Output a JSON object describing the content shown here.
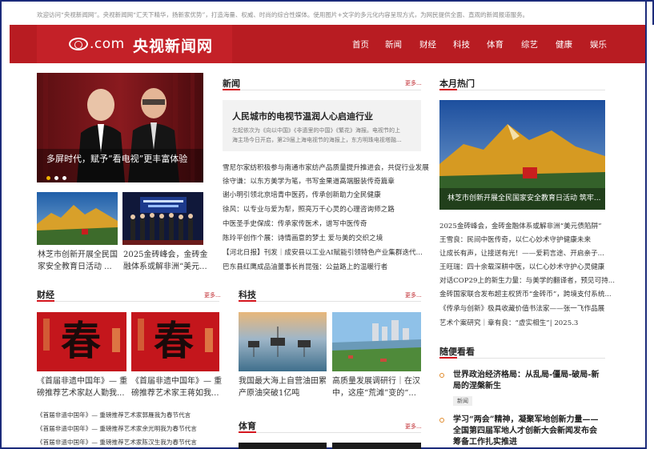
{
  "top_note": "欢迎访问“央视新闻网”。央视新闻网“汇天下精华，扬新家优势”，打造海量、权威、时尚的综合性媒体。使用图片+文字的多元化内容呈现方式，为网民提供全面、直观的新闻报道服务。",
  "logo": {
    "en": ".com",
    "cn": "央视新闻网"
  },
  "nav": [
    "首页",
    "新闻",
    "财经",
    "科技",
    "体育",
    "综艺",
    "健康",
    "娱乐"
  ],
  "slider": {
    "caption": "多屏时代，赋予“看电视”更丰富体验",
    "dots": 3,
    "active": 0
  },
  "thumbs": [
    {
      "caption_1": "林芝市创新开展全民国",
      "caption_2": "家安全教育日活动 ..."
    },
    {
      "caption_1": "2025金砖峰会，金砖金",
      "caption_2": "融体系或解非洲“美元..."
    }
  ],
  "news": {
    "title": "新闻",
    "more": "更多...",
    "featured": {
      "title": "人民城市的电视节温润人心启迪行业",
      "summary_1": "左起依次为《向以中国》《非遗里的中国》《繁花》海报。电视节的上",
      "summary_2": "海主场今日开启，第29届上海电视节的海报上，东方明珠电视塔融..."
    },
    "items": [
      "雪尼尔家纺积极参与南通市家纺产品质量提升推进会，共促行业发展",
      "徐守谦：以东方美学为笔，书写金果道高端服装传奇篇章",
      "谢小明引领北京培青中医药，传承创新助力全民健康",
      "徐风：以专业与爱为犁，照亮万千心灵的心理咨询师之路",
      "中医圣手史保成：传承家传医术，谱写中医传奇",
      "陈玲平创作个展：诗情画意的梦土 爱与美的交织之境",
      "【河北日报】刊发｜成安县以工业AI赋能引领特色产业集群迭代...",
      "巴东县红鹰成品油董事长肖昆强：公益路上的温暖行者"
    ]
  },
  "hot": {
    "title": "本月热门",
    "image_caption": "林芝市创新开展全民国家安全教育日活动 筑牢...",
    "items": [
      "2025金砖峰会，金砖金融体系或解非洲“美元债陷阱”",
      "王雪良：民间中医传奇，以仁心妙术守护健康未来",
      "让成长有声，让接送有光！——爱莉言途、开启亲子...",
      "王旺瑞：四十余载深耕中医，以仁心妙术守护心灵健康",
      "对话COP29上的新生力量：与美学的翻译者，预见可持...",
      "金砖国家联合发布超主权货币“金砖币”，跨境支付系统...",
      "《传承与创新》极具收藏价值书法家——张一飞作品展",
      "艺术个案研究｜章有良：“虚实相生”| 2025.3"
    ]
  },
  "finance": {
    "title": "财经",
    "more": "更多...",
    "cards": [
      {
        "caption_1": "《首届非遗中国年》— 重",
        "caption_2": "磅推荐艺术家赵人勤我..."
      },
      {
        "caption_1": "《首届非遗中国年》— 重",
        "caption_2": "磅推荐艺术家王蒋如我..."
      }
    ],
    "list": [
      "《首届非遗中国年》— 重磅推荐艺术家郭雁我为春节代言",
      "《首届非遗中国年》— 重磅推荐艺术家余光明我为春节代言",
      "《首届非遗中国年》— 重磅推荐艺术家陈汉生我为春节代言"
    ],
    "poster_char": "春"
  },
  "tech": {
    "title": "科技",
    "more": "更多...",
    "cards": [
      {
        "caption_1": "我国最大海上自营油田累",
        "caption_2": "产原油突破1亿吨"
      },
      {
        "caption_1": "高质量发展调研行｜在汉",
        "caption_2": "中，这座“荒滩”变的“..."
      }
    ]
  },
  "sports": {
    "title": "体育",
    "more": "更多..."
  },
  "random": {
    "title": "随便看看",
    "items": [
      {
        "title_1": "世界政治经济格局：从乱局-僵局-破局-新",
        "title_2": "局的涅槃新生",
        "tag": "新闻"
      },
      {
        "title_1": "学习“两会”精神，凝聚军地创新力量——",
        "title_2": "全国第四届军地人才创新大会新闻发布会",
        "title_3": "筹备工作扎实推进"
      }
    ]
  },
  "colors": {
    "brand_red": "#b81c22",
    "accent": "#d4161e",
    "border_blue": "#1b2b7a"
  }
}
